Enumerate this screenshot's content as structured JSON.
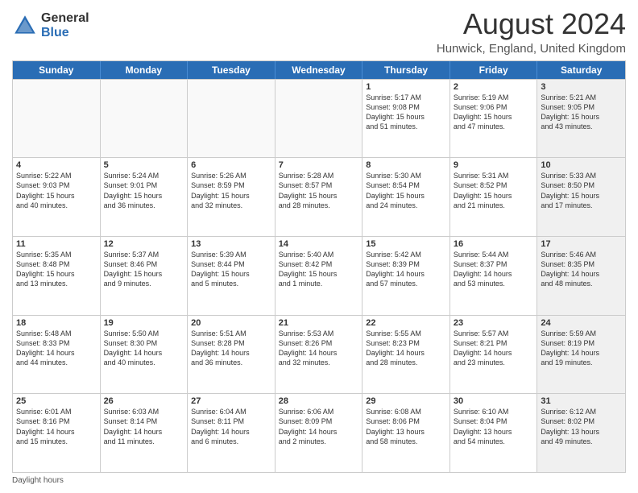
{
  "logo": {
    "general": "General",
    "blue": "Blue"
  },
  "title": "August 2024",
  "subtitle": "Hunwick, England, United Kingdom",
  "footer": "Daylight hours",
  "headers": [
    "Sunday",
    "Monday",
    "Tuesday",
    "Wednesday",
    "Thursday",
    "Friday",
    "Saturday"
  ],
  "rows": [
    [
      {
        "day": "",
        "text": "",
        "empty": true
      },
      {
        "day": "",
        "text": "",
        "empty": true
      },
      {
        "day": "",
        "text": "",
        "empty": true
      },
      {
        "day": "",
        "text": "",
        "empty": true
      },
      {
        "day": "1",
        "text": "Sunrise: 5:17 AM\nSunset: 9:08 PM\nDaylight: 15 hours\nand 51 minutes.",
        "empty": false
      },
      {
        "day": "2",
        "text": "Sunrise: 5:19 AM\nSunset: 9:06 PM\nDaylight: 15 hours\nand 47 minutes.",
        "empty": false
      },
      {
        "day": "3",
        "text": "Sunrise: 5:21 AM\nSunset: 9:05 PM\nDaylight: 15 hours\nand 43 minutes.",
        "empty": false,
        "shaded": true
      }
    ],
    [
      {
        "day": "4",
        "text": "Sunrise: 5:22 AM\nSunset: 9:03 PM\nDaylight: 15 hours\nand 40 minutes.",
        "empty": false
      },
      {
        "day": "5",
        "text": "Sunrise: 5:24 AM\nSunset: 9:01 PM\nDaylight: 15 hours\nand 36 minutes.",
        "empty": false
      },
      {
        "day": "6",
        "text": "Sunrise: 5:26 AM\nSunset: 8:59 PM\nDaylight: 15 hours\nand 32 minutes.",
        "empty": false
      },
      {
        "day": "7",
        "text": "Sunrise: 5:28 AM\nSunset: 8:57 PM\nDaylight: 15 hours\nand 28 minutes.",
        "empty": false
      },
      {
        "day": "8",
        "text": "Sunrise: 5:30 AM\nSunset: 8:54 PM\nDaylight: 15 hours\nand 24 minutes.",
        "empty": false
      },
      {
        "day": "9",
        "text": "Sunrise: 5:31 AM\nSunset: 8:52 PM\nDaylight: 15 hours\nand 21 minutes.",
        "empty": false
      },
      {
        "day": "10",
        "text": "Sunrise: 5:33 AM\nSunset: 8:50 PM\nDaylight: 15 hours\nand 17 minutes.",
        "empty": false,
        "shaded": true
      }
    ],
    [
      {
        "day": "11",
        "text": "Sunrise: 5:35 AM\nSunset: 8:48 PM\nDaylight: 15 hours\nand 13 minutes.",
        "empty": false
      },
      {
        "day": "12",
        "text": "Sunrise: 5:37 AM\nSunset: 8:46 PM\nDaylight: 15 hours\nand 9 minutes.",
        "empty": false
      },
      {
        "day": "13",
        "text": "Sunrise: 5:39 AM\nSunset: 8:44 PM\nDaylight: 15 hours\nand 5 minutes.",
        "empty": false
      },
      {
        "day": "14",
        "text": "Sunrise: 5:40 AM\nSunset: 8:42 PM\nDaylight: 15 hours\nand 1 minute.",
        "empty": false
      },
      {
        "day": "15",
        "text": "Sunrise: 5:42 AM\nSunset: 8:39 PM\nDaylight: 14 hours\nand 57 minutes.",
        "empty": false
      },
      {
        "day": "16",
        "text": "Sunrise: 5:44 AM\nSunset: 8:37 PM\nDaylight: 14 hours\nand 53 minutes.",
        "empty": false
      },
      {
        "day": "17",
        "text": "Sunrise: 5:46 AM\nSunset: 8:35 PM\nDaylight: 14 hours\nand 48 minutes.",
        "empty": false,
        "shaded": true
      }
    ],
    [
      {
        "day": "18",
        "text": "Sunrise: 5:48 AM\nSunset: 8:33 PM\nDaylight: 14 hours\nand 44 minutes.",
        "empty": false
      },
      {
        "day": "19",
        "text": "Sunrise: 5:50 AM\nSunset: 8:30 PM\nDaylight: 14 hours\nand 40 minutes.",
        "empty": false
      },
      {
        "day": "20",
        "text": "Sunrise: 5:51 AM\nSunset: 8:28 PM\nDaylight: 14 hours\nand 36 minutes.",
        "empty": false
      },
      {
        "day": "21",
        "text": "Sunrise: 5:53 AM\nSunset: 8:26 PM\nDaylight: 14 hours\nand 32 minutes.",
        "empty": false
      },
      {
        "day": "22",
        "text": "Sunrise: 5:55 AM\nSunset: 8:23 PM\nDaylight: 14 hours\nand 28 minutes.",
        "empty": false
      },
      {
        "day": "23",
        "text": "Sunrise: 5:57 AM\nSunset: 8:21 PM\nDaylight: 14 hours\nand 23 minutes.",
        "empty": false
      },
      {
        "day": "24",
        "text": "Sunrise: 5:59 AM\nSunset: 8:19 PM\nDaylight: 14 hours\nand 19 minutes.",
        "empty": false,
        "shaded": true
      }
    ],
    [
      {
        "day": "25",
        "text": "Sunrise: 6:01 AM\nSunset: 8:16 PM\nDaylight: 14 hours\nand 15 minutes.",
        "empty": false
      },
      {
        "day": "26",
        "text": "Sunrise: 6:03 AM\nSunset: 8:14 PM\nDaylight: 14 hours\nand 11 minutes.",
        "empty": false
      },
      {
        "day": "27",
        "text": "Sunrise: 6:04 AM\nSunset: 8:11 PM\nDaylight: 14 hours\nand 6 minutes.",
        "empty": false
      },
      {
        "day": "28",
        "text": "Sunrise: 6:06 AM\nSunset: 8:09 PM\nDaylight: 14 hours\nand 2 minutes.",
        "empty": false
      },
      {
        "day": "29",
        "text": "Sunrise: 6:08 AM\nSunset: 8:06 PM\nDaylight: 13 hours\nand 58 minutes.",
        "empty": false
      },
      {
        "day": "30",
        "text": "Sunrise: 6:10 AM\nSunset: 8:04 PM\nDaylight: 13 hours\nand 54 minutes.",
        "empty": false
      },
      {
        "day": "31",
        "text": "Sunrise: 6:12 AM\nSunset: 8:02 PM\nDaylight: 13 hours\nand 49 minutes.",
        "empty": false,
        "shaded": true
      }
    ]
  ]
}
